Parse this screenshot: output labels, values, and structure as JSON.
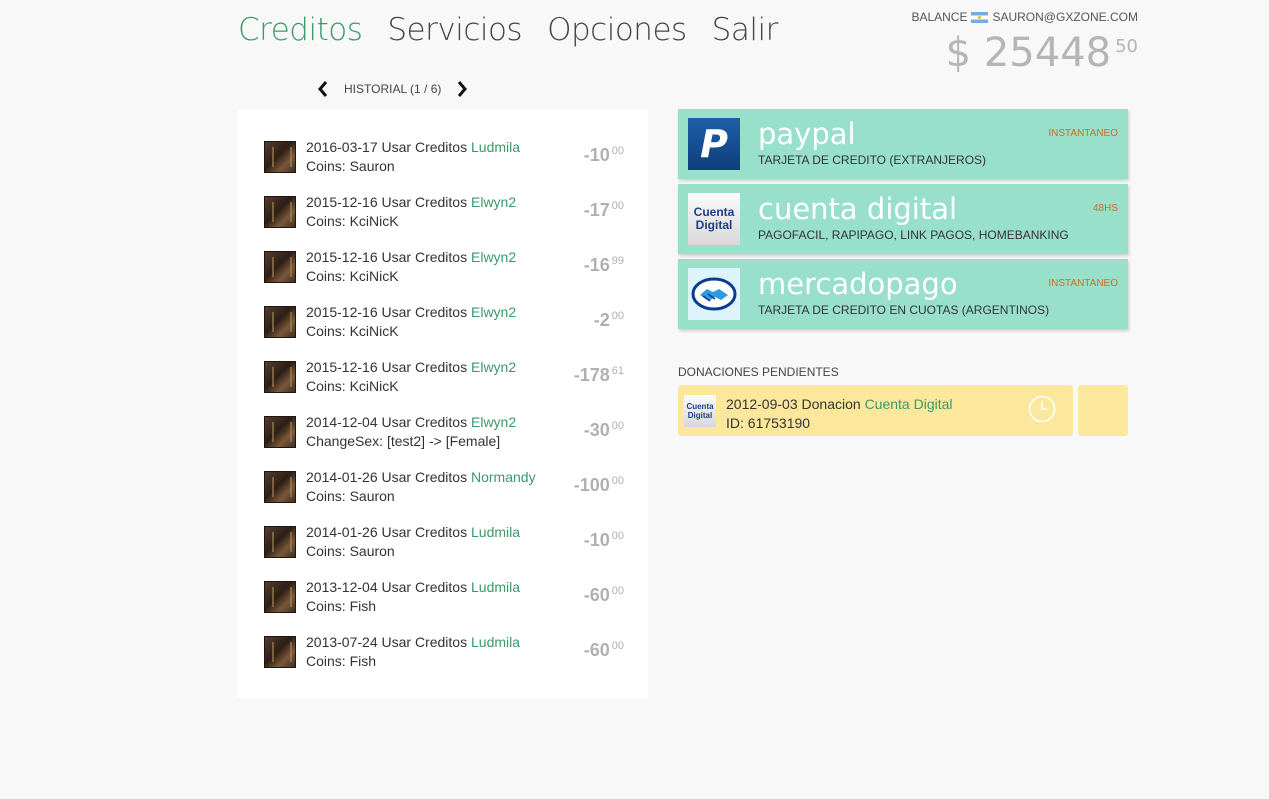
{
  "nav": {
    "items": [
      "Creditos",
      "Servicios",
      "Opciones",
      "Salir"
    ]
  },
  "balance": {
    "label": "BALANCE",
    "email": "SAURON@GXZONE.COM",
    "currency": "$",
    "amount": "25448",
    "cents": "50"
  },
  "history": {
    "label": "HISTORIAL (1 / 6)",
    "rows": [
      {
        "date": "2016-03-17",
        "action": "Usar Creditos",
        "user": "Ludmila",
        "detail": "Coins: Sauron",
        "amount": "-10",
        "cents": "00"
      },
      {
        "date": "2015-12-16",
        "action": "Usar Creditos",
        "user": "Elwyn2",
        "detail": "Coins: KciNicK",
        "amount": "-17",
        "cents": "00"
      },
      {
        "date": "2015-12-16",
        "action": "Usar Creditos",
        "user": "Elwyn2",
        "detail": "Coins: KciNicK",
        "amount": "-16",
        "cents": "99"
      },
      {
        "date": "2015-12-16",
        "action": "Usar Creditos",
        "user": "Elwyn2",
        "detail": "Coins: KciNicK",
        "amount": "-2",
        "cents": "00"
      },
      {
        "date": "2015-12-16",
        "action": "Usar Creditos",
        "user": "Elwyn2",
        "detail": "Coins: KciNicK",
        "amount": "-178",
        "cents": "61"
      },
      {
        "date": "2014-12-04",
        "action": "Usar Creditos",
        "user": "Elwyn2",
        "detail": "ChangeSex: [test2] -> [Female]",
        "amount": "-30",
        "cents": "00"
      },
      {
        "date": "2014-01-26",
        "action": "Usar Creditos",
        "user": "Normandy",
        "detail": "Coins: Sauron",
        "amount": "-100",
        "cents": "00"
      },
      {
        "date": "2014-01-26",
        "action": "Usar Creditos",
        "user": "Ludmila",
        "detail": "Coins: Sauron",
        "amount": "-10",
        "cents": "00"
      },
      {
        "date": "2013-12-04",
        "action": "Usar Creditos",
        "user": "Ludmila",
        "detail": "Coins: Fish",
        "amount": "-60",
        "cents": "00"
      },
      {
        "date": "2013-07-24",
        "action": "Usar Creditos",
        "user": "Ludmila",
        "detail": "Coins: Fish",
        "amount": "-60",
        "cents": "00"
      }
    ]
  },
  "payments": [
    {
      "name": "paypal",
      "desc": "TARJETA DE CREDITO (EXTRANJEROS)",
      "tag": "INSTANTANEO",
      "icon": "paypal-logo"
    },
    {
      "name": "cuenta digital",
      "desc": "PAGOFACIL, RAPIPAGO, LINK PAGOS, HOMEBANKING",
      "tag": "48HS",
      "icon": "cuenta-digital-logo",
      "logo_text": [
        "Cuenta",
        "Digital"
      ]
    },
    {
      "name": "mercadopago",
      "desc": "TARJETA DE CREDITO EN CUOTAS (ARGENTINOS)",
      "tag": "INSTANTANEO",
      "icon": "mercadopago-logo"
    }
  ],
  "pending": {
    "title": "DONACIONES PENDIENTES",
    "items": [
      {
        "date": "2012-09-03",
        "action": "Donacion",
        "method": "Cuenta Digital",
        "id": "ID: 61753190",
        "logo_text": [
          "Cuenta",
          "Digital"
        ]
      }
    ]
  },
  "colors": {
    "accent": "#3a9a6a",
    "card": "#98e0ca",
    "pending": "#fbe89c",
    "tag": "#d16a2a"
  }
}
